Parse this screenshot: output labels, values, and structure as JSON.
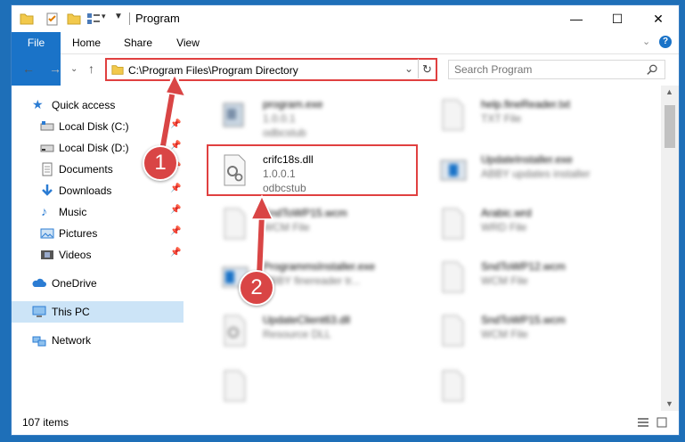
{
  "window": {
    "title": "Program",
    "controls": {
      "minimize": "—",
      "maximize": "☐",
      "close": "✕"
    }
  },
  "ribbon": {
    "tabs": [
      {
        "label": "File"
      },
      {
        "label": "Home"
      },
      {
        "label": "Share"
      },
      {
        "label": "View"
      }
    ]
  },
  "address": {
    "path": "C:\\Program Files\\Program Directory",
    "search_placeholder": "Search Program"
  },
  "nav": {
    "items": [
      {
        "label": "Quick access",
        "icon": "star-icon"
      },
      {
        "label": "Local Disk (C:)",
        "icon": "drive-icon"
      },
      {
        "label": "Local Disk (D:)",
        "icon": "drive-icon"
      },
      {
        "label": "Documents",
        "icon": "documents-icon"
      },
      {
        "label": "Downloads",
        "icon": "download-icon"
      },
      {
        "label": "Music",
        "icon": "music-icon"
      },
      {
        "label": "Pictures",
        "icon": "pictures-icon"
      },
      {
        "label": "Videos",
        "icon": "video-icon"
      },
      {
        "label": "OneDrive",
        "icon": "cloud-icon"
      },
      {
        "label": "This PC",
        "icon": "computer-icon"
      },
      {
        "label": "Network",
        "icon": "network-icon"
      }
    ]
  },
  "files": [
    {
      "name": "program.exe",
      "line1": "1.0.0.1",
      "line2": "odbcstub"
    },
    {
      "name": "help.fineReader.txt",
      "line1": "TXT File",
      "line2": ""
    },
    {
      "name": "crifc18s.dll",
      "line1": "1.0.0.1",
      "line2": "odbcstub"
    },
    {
      "name": "UpdateInstaller.exe",
      "line1": "ABBY updates installer",
      "line2": ""
    },
    {
      "name": "SndToWP15.wcm",
      "line1": "WCM File",
      "line2": ""
    },
    {
      "name": "Arabic.wrd",
      "line1": "WRD File",
      "line2": ""
    },
    {
      "name": "ProgrammsInstaller.exe",
      "line1": "ABBY finereader tr...",
      "line2": ""
    },
    {
      "name": "SndToWP12.wcm",
      "line1": "WCM File",
      "line2": ""
    },
    {
      "name": "UpdateClient63.dll",
      "line1": "Resource DLL",
      "line2": ""
    },
    {
      "name": "SndToWP15.wcm",
      "line1": "WCM File",
      "line2": ""
    }
  ],
  "status": {
    "item_count": "107 items"
  },
  "annotations": {
    "step1": "1",
    "step2": "2"
  },
  "colors": {
    "accent": "#1a73c8",
    "highlight": "#e04040",
    "selected": "#cce4f7"
  }
}
